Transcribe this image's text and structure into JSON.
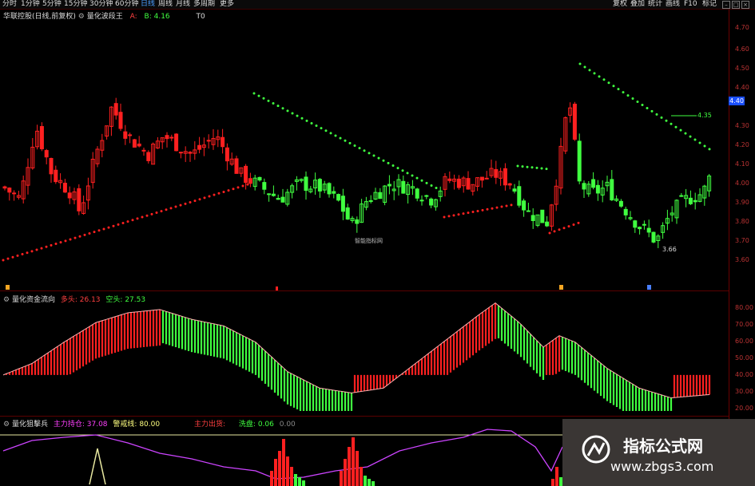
{
  "toolbar": {
    "periods": [
      "分时",
      "1分钟",
      "5分钟",
      "15分钟",
      "30分钟",
      "60分钟",
      "日线",
      "周线",
      "月线",
      "多周期",
      "更多"
    ],
    "active_period": "日线",
    "right_buttons": [
      "复权",
      "叠加",
      "统计",
      "画线",
      "F10",
      "标记"
    ]
  },
  "main_panel": {
    "stock_name": "华联控股(日线,前复权)",
    "indicator_name": "量化波段王",
    "indicator_values": [
      {
        "label": "A:",
        "value": "",
        "color": "#ff4040"
      },
      {
        "label": "B:",
        "value": "4.16",
        "color": "#40ff40"
      }
    ],
    "t0_label": "T0",
    "y_ticks": [
      "4.70",
      "4.60",
      "4.50",
      "4.40",
      "4.30",
      "4.20",
      "4.10",
      "4.00",
      "3.90",
      "3.80",
      "3.70",
      "3.60"
    ],
    "current_price_tag": "4.40",
    "annotation_high": "4.35",
    "annotation_low": "3.66",
    "watermark_center": "智能指标网"
  },
  "flow_panel": {
    "indicator_name": "量化资金流向",
    "label_long": "多头:",
    "value_long": "26.13",
    "label_short": "空头:",
    "value_short": "27.53",
    "y_ticks": [
      "80.00",
      "70.00",
      "60.00",
      "50.00",
      "40.00",
      "30.00",
      "20.00"
    ]
  },
  "sniper_panel": {
    "indicator_name": "量化狙擊兵",
    "labels": [
      {
        "label": "主力持仓:",
        "value": "37.08",
        "color": "#ff40ff"
      },
      {
        "label": "警戒线:",
        "value": "80.00",
        "color": "#ffff80"
      },
      {
        "label": "主力出货:",
        "value": "",
        "color": "#ff4040"
      },
      {
        "label": "洗盘:",
        "value": "0.06",
        "color": "#40ff40"
      },
      {
        "label": "",
        "value": "0.00",
        "color": "#888"
      }
    ]
  },
  "watermark": {
    "title": "指标公式网",
    "url": "www.zbgs3.com"
  },
  "colors": {
    "up": "#ff2020",
    "down": "#40ff40",
    "purple": "#cc44ff",
    "warn": "#e8e8a0",
    "axis": "#b33"
  }
}
